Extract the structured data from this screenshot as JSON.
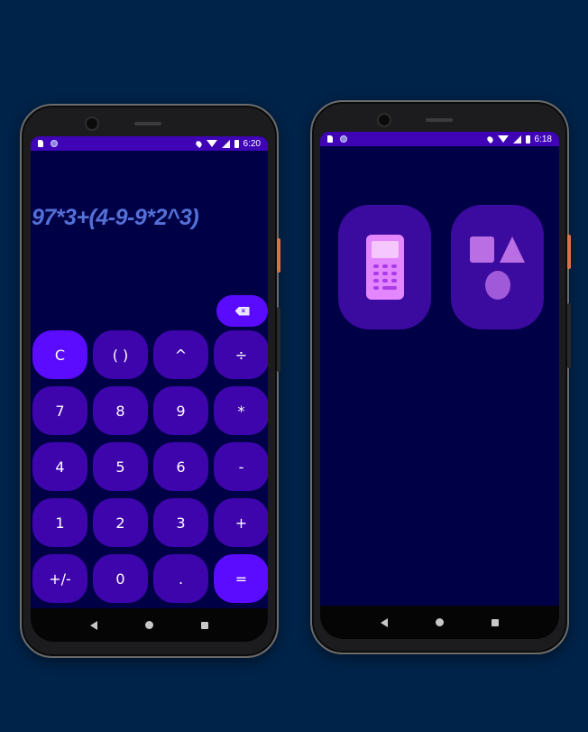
{
  "left_phone": {
    "status_bar": {
      "time": "6:20",
      "icons": [
        "sd-card-icon",
        "circle-notification-icon",
        "location-icon",
        "wifi-icon",
        "signal-icon",
        "battery-icon"
      ]
    },
    "expression": "97*3+(4-9-9*2^3)",
    "backspace_icon": "backspace-icon",
    "keys": [
      [
        "C",
        "( )",
        "^",
        "÷"
      ],
      [
        "7",
        "8",
        "9",
        "*"
      ],
      [
        "4",
        "5",
        "6",
        "-"
      ],
      [
        "1",
        "2",
        "3",
        "+"
      ],
      [
        "+/-",
        "0",
        ".",
        "="
      ]
    ]
  },
  "right_phone": {
    "status_bar": {
      "time": "6:18",
      "icons": [
        "sd-card-icon",
        "circle-notification-icon",
        "location-icon",
        "wifi-icon",
        "signal-icon",
        "battery-icon"
      ]
    },
    "launcher_items": [
      {
        "icon": "calculator-icon"
      },
      {
        "icon": "shapes-icon"
      }
    ]
  },
  "colors": {
    "background": "#002349",
    "screen": "#000046",
    "status_bar": "#3e04b6",
    "key": "#3f05ad",
    "accent_key": "#5b0bfe",
    "expression": "#5470d6",
    "tile": "#3b0a9e",
    "icon_pink": "#e487ff"
  },
  "nav_icons": [
    "back-icon",
    "home-icon",
    "recent-apps-icon"
  ]
}
